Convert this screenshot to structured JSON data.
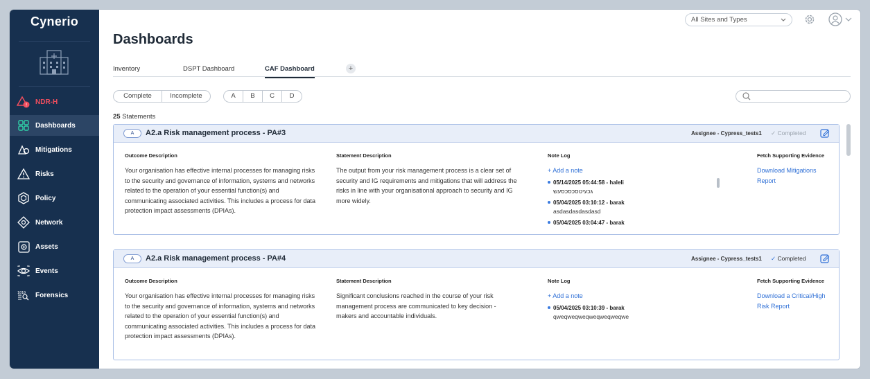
{
  "app": {
    "logo": "Cynerio"
  },
  "sidebar": {
    "items": [
      {
        "label": "NDR-H",
        "icon": "ndr-shield-icon"
      },
      {
        "label": "Dashboards",
        "icon": "dashboard-grid-icon"
      },
      {
        "label": "Mitigations",
        "icon": "mitigations-icon"
      },
      {
        "label": "Risks",
        "icon": "warning-icon"
      },
      {
        "label": "Policy",
        "icon": "policy-hexagon-icon"
      },
      {
        "label": "Network",
        "icon": "network-icon"
      },
      {
        "label": "Assets",
        "icon": "assets-icon"
      },
      {
        "label": "Events",
        "icon": "events-eye-icon"
      },
      {
        "label": "Forensics",
        "icon": "forensics-icon"
      }
    ],
    "active": "Dashboards"
  },
  "header": {
    "title": "Dashboards",
    "site_select": "All Sites and Types"
  },
  "tabs": [
    {
      "label": "Inventory"
    },
    {
      "label": "DSPT Dashboard"
    },
    {
      "label": "CAF Dashboard",
      "active": true
    }
  ],
  "tab_add": "+",
  "filters": {
    "status": [
      "Complete",
      "Incomplete"
    ],
    "levels": [
      "A",
      "B",
      "C",
      "D"
    ]
  },
  "statements_count": "25",
  "statements_label": "Statements",
  "labels": {
    "outcome": "Outcome Description",
    "statement": "Statement Description",
    "note_log": "Note Log",
    "evidence": "Fetch Supporting Evidence",
    "add_note": "+ Add a note"
  },
  "cards": [
    {
      "level": "A",
      "title": "A2.a Risk management process - PA#3",
      "assignee": "Assignee - Cypress_tests1",
      "status": "Completed",
      "outcome": "Your organisation has effective internal processes for managing risks to the security and governance of information, systems and networks related to the operation of your essential function(s) and communicating associated activities. This includes a process for data protection impact assessments (DPIAs).",
      "statement": "The output from your risk management process is a clear set of security and IG requirements and mitigations that will address the risks in line with your organisational approach to security and IG more widely.",
      "notes": [
        {
          "when": "05/14/2025 05:44:58 - haleli",
          "text": "גכעיטסכסכסעש"
        },
        {
          "when": "05/04/2025 03:10:12 - barak",
          "text": "asdasdasdasdasd"
        },
        {
          "when": "05/04/2025 03:04:47 - barak",
          "text": ""
        }
      ],
      "evidence": "Download Mitigations Report"
    },
    {
      "level": "A",
      "title": "A2.a Risk management process - PA#4",
      "assignee": "Assignee - Cypress_tests1",
      "status": "Completed",
      "outcome": "Your organisation has effective internal processes for managing risks to the security and governance of information, systems and networks related to the operation of your essential function(s) and communicating associated activities. This includes a process for data protection impact assessments (DPIAs).",
      "statement": "Significant conclusions reached in the course of your risk management process are communicated to key decision - makers and accountable individuals.",
      "notes": [
        {
          "when": "05/04/2025 03:10:39 - barak",
          "text": "qweqweqweqweqweqweqwe"
        }
      ],
      "evidence": "Download a Critical/High Risk Report"
    }
  ]
}
